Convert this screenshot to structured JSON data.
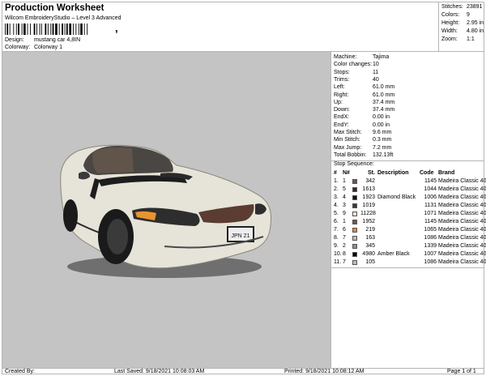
{
  "header": {
    "title": "Production Worksheet",
    "subtitle": "Wilcom EmbroideryStudio – Level 3 Advanced",
    "design_label": "Design:",
    "design_value": "mustang car 4,8IN",
    "colorway_label": "Colorway:",
    "colorway_value": "Colorway 1"
  },
  "stats": [
    {
      "label": "Stitches:",
      "value": "23891"
    },
    {
      "label": "Colors:",
      "value": "9"
    },
    {
      "label": "Height:",
      "value": "2.95 in"
    },
    {
      "label": "Width:",
      "value": "4.80 in"
    },
    {
      "label": "Zoom:",
      "value": "1:1"
    }
  ],
  "machine_info": [
    {
      "label": "Machine:",
      "value": "Tajima"
    },
    {
      "label": "Color changes:",
      "value": "10"
    },
    {
      "label": "Stops:",
      "value": "11"
    },
    {
      "label": "Trims:",
      "value": "40"
    },
    {
      "label": "Left:",
      "value": "61.0 mm"
    },
    {
      "label": "Right:",
      "value": "61.0 mm"
    },
    {
      "label": "Up:",
      "value": "37.4 mm"
    },
    {
      "label": "Down:",
      "value": "37.4 mm"
    },
    {
      "label": "EndX:",
      "value": "0.00 in"
    },
    {
      "label": "EndY:",
      "value": "0.00 in"
    },
    {
      "label": "Max Stitch:",
      "value": "9.6 mm"
    },
    {
      "label": "Min Stitch:",
      "value": "0.3 mm"
    },
    {
      "label": "Max Jump:",
      "value": "7.2 mm"
    },
    {
      "label": "Total Bobbin:",
      "value": "132.13ft"
    }
  ],
  "sequence": {
    "title": "Stop Sequence:",
    "headers": {
      "num": "#",
      "n": "N#",
      "st": "St.",
      "desc": "Description",
      "code": "Code",
      "brand": "Brand"
    },
    "rows": [
      {
        "num": "1.",
        "n": "1",
        "color": "#6e5548",
        "st": "342",
        "desc": "",
        "code": "1145",
        "brand": "Madeira Classic 40"
      },
      {
        "num": "2.",
        "n": "5",
        "color": "#2c2c2c",
        "st": "1613",
        "desc": "",
        "code": "1044",
        "brand": "Madeira Classic 40"
      },
      {
        "num": "3.",
        "n": "4",
        "color": "#111111",
        "st": "1923",
        "desc": "Diamond Black",
        "code": "1006",
        "brand": "Madeira Classic 40"
      },
      {
        "num": "4.",
        "n": "3",
        "color": "#3a3a3a",
        "st": "1019",
        "desc": "",
        "code": "1131",
        "brand": "Madeira Classic 40"
      },
      {
        "num": "5.",
        "n": "9",
        "color": "#f0e2de",
        "st": "11228",
        "desc": "",
        "code": "1071",
        "brand": "Madeira Classic 40"
      },
      {
        "num": "6.",
        "n": "1",
        "color": "#6e5548",
        "st": "1952",
        "desc": "",
        "code": "1145",
        "brand": "Madeira Classic 40"
      },
      {
        "num": "7.",
        "n": "6",
        "color": "#e38a2c",
        "st": "219",
        "desc": "",
        "code": "1065",
        "brand": "Madeira Classic 40"
      },
      {
        "num": "8.",
        "n": "7",
        "color": "#bcbcbc",
        "st": "163",
        "desc": "",
        "code": "1086",
        "brand": "Madeira Classic 40"
      },
      {
        "num": "9.",
        "n": "2",
        "color": "#8e8e8e",
        "st": "345",
        "desc": "",
        "code": "1339",
        "brand": "Madeira Classic 40"
      },
      {
        "num": "10.",
        "n": "8",
        "color": "#050505",
        "st": "4980",
        "desc": "Amber Black",
        "code": "1007",
        "brand": "Madeira Classic 40"
      },
      {
        "num": "11.",
        "n": "7",
        "color": "#bcbcbc",
        "st": "105",
        "desc": "",
        "code": "1086",
        "brand": "Madeira Classic 40"
      }
    ]
  },
  "design_image": {
    "plate_text": "JPN 21"
  },
  "footer": {
    "created": "Created By:",
    "saved": "Last Saved: 9/18/2021 10:08:03 AM",
    "printed": "Printed: 9/18/2021 10:08:12 AM",
    "page": "Page 1 of 1"
  }
}
